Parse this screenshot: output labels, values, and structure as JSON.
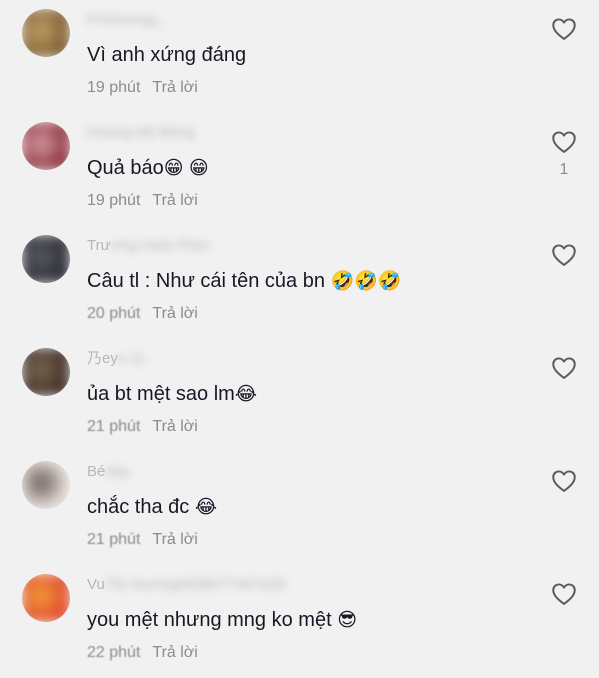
{
  "comments": [
    {
      "username_visible": "",
      "username_hidden": "Pmimmojy_",
      "text": "Vì anh xứng đáng",
      "emoji": "",
      "time": "19 phút",
      "reply_label": "Trả lời",
      "like_count": "",
      "avatar_colors": [
        "#7a5a2e",
        "#c7a36a"
      ]
    },
    {
      "username_visible": "",
      "username_hidden": "Hoàng Mỹ Bông",
      "text": "Quả báo",
      "emoji": "😁 😁",
      "time": "19 phút",
      "reply_label": "Trả lời",
      "like_count": "1",
      "avatar_colors": [
        "#8c2e3a",
        "#d6a0a8"
      ]
    },
    {
      "username_visible": "Trư",
      "username_hidden": "ơng Hoài Phúc",
      "text": "Câu tl : Như cái tên của bn ",
      "emoji": "🤣🤣🤣",
      "time": "20 phút",
      "reply_label": "Trả lời",
      "like_count": "",
      "avatar_colors": [
        "#2a2a33",
        "#5c5c66"
      ]
    },
    {
      "username_visible": "乃ey",
      "username_hidden": "ọ ◎ -",
      "text": "ủa bt mệt sao lm",
      "emoji": "😂",
      "time": "21 phút",
      "reply_label": "Trả lời",
      "like_count": "",
      "avatar_colors": [
        "#3d2b22",
        "#7d6a55"
      ]
    },
    {
      "username_visible": "Bé",
      "username_hidden": "dạy",
      "text": "chắc tha đc ",
      "emoji": "😂",
      "time": "21 phút",
      "reply_label": "Trả lời",
      "like_count": "",
      "avatar_colors": [
        "#e8e2dc",
        "#6a5a55"
      ]
    },
    {
      "username_visible": "Vu",
      "username_hidden": "Thị Hương0838677497e20",
      "text": "you mệt nhưng mng ko mệt ",
      "emoji": "😎",
      "time": "22 phút",
      "reply_label": "Trả lời",
      "like_count": "",
      "avatar_colors": [
        "#e0452b",
        "#f2a13a"
      ]
    }
  ],
  "icons": {
    "like": "heart-outline-icon"
  },
  "colors": {
    "background": "#f1f1f2",
    "text": "#161823",
    "secondary": "#8a8b91"
  }
}
